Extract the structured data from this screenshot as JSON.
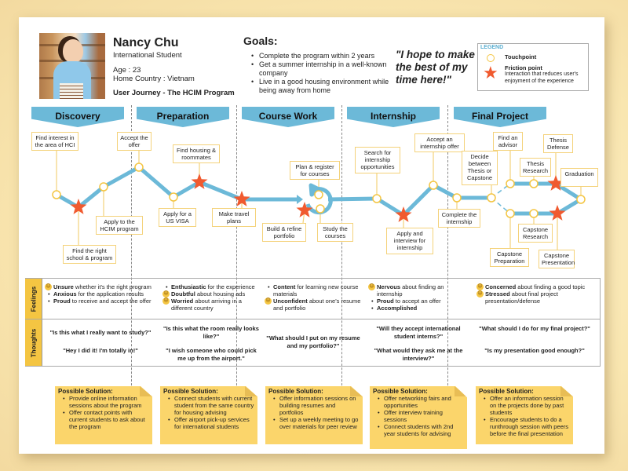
{
  "persona": {
    "name": "Nancy Chu",
    "role": "International Student",
    "age": "Age : 23",
    "country": "Home Country : Vietnam",
    "journey_title": "User Journey - The HCIM Program",
    "photo_icon": "persona-photo"
  },
  "goals": {
    "title": "Goals:",
    "items": [
      "Complete the program within 2 years",
      "Get a summer internship in a well-known company",
      "Live in a good housing environment while being away from home"
    ]
  },
  "quote": "\"I hope to make the best of my time here!\"",
  "legend": {
    "title": "LEGEND",
    "touchpoint_label": "Touchpoint",
    "friction_label": "Friction point",
    "friction_desc": "Interaction that reduces user's enjoyment of the experience",
    "touchpoint_icon": "circle-outline",
    "friction_icon": "star"
  },
  "colors": {
    "phase_header": "#6cb9d8",
    "path": "#6cb9d8",
    "touchpoint": "#f4c542",
    "friction": "#f05a2f",
    "note": "#fbd56b"
  },
  "phases": [
    {
      "label": "Discovery"
    },
    {
      "label": "Preparation"
    },
    {
      "label": "Course Work"
    },
    {
      "label": "Internship"
    },
    {
      "label": "Final Project"
    }
  ],
  "steps": [
    {
      "label": "Find interest in the area of HCI",
      "type": "touchpoint"
    },
    {
      "label": "Find the right school & program",
      "type": "friction"
    },
    {
      "label": "Apply to the HCIM program",
      "type": "touchpoint"
    },
    {
      "label": "Accept the offer",
      "type": "touchpoint"
    },
    {
      "label": "Apply for a US VISA",
      "type": "touchpoint"
    },
    {
      "label": "Find housing & roommates",
      "type": "friction"
    },
    {
      "label": "Make travel plans",
      "type": "friction"
    },
    {
      "label": "Plan & register for courses",
      "type": "touchpoint"
    },
    {
      "label": "Build & refine portfolio",
      "type": "friction"
    },
    {
      "label": "Study the courses",
      "type": "touchpoint"
    },
    {
      "label": "Search for internship opportunities",
      "type": "touchpoint"
    },
    {
      "label": "Apply and interview for internship",
      "type": "friction"
    },
    {
      "label": "Accept an internship offer",
      "type": "touchpoint"
    },
    {
      "label": "Complete the internship",
      "type": "touchpoint"
    },
    {
      "label": "Decide between Thesis or Capstone",
      "type": "touchpoint"
    },
    {
      "label": "Find an advisor",
      "type": "touchpoint"
    },
    {
      "label": "Thesis Research",
      "type": "touchpoint"
    },
    {
      "label": "Thesis Defense",
      "type": "friction"
    },
    {
      "label": "Capstone Preparation",
      "type": "touchpoint"
    },
    {
      "label": "Capstone Research",
      "type": "touchpoint"
    },
    {
      "label": "Capstone Presentation",
      "type": "friction"
    },
    {
      "label": "Graduation",
      "type": "touchpoint"
    }
  ],
  "rows": {
    "feelings_label": "Feelings",
    "thoughts_label": "Thoughts"
  },
  "feelings": [
    [
      {
        "marker": "sad",
        "bold": "Unsure",
        "rest": " whether it's the right program"
      },
      {
        "marker": "bullet",
        "bold": "Anxious",
        "rest": " for the application results"
      },
      {
        "marker": "bullet",
        "bold": "Proud",
        "rest": " to receive and accept the offer"
      }
    ],
    [
      {
        "marker": "bullet",
        "bold": "Enthusiastic",
        "rest": " for the experience"
      },
      {
        "marker": "sad",
        "bold": "Doubtful",
        "rest": " about housing ads"
      },
      {
        "marker": "sad",
        "bold": "Worried",
        "rest": " about arriving in a different country"
      }
    ],
    [
      {
        "marker": "bullet",
        "bold": "Content",
        "rest": " for learning new course materials"
      },
      {
        "marker": "sad",
        "bold": "Unconfident",
        "rest": " about one's resume and portfolio"
      }
    ],
    [
      {
        "marker": "sad",
        "bold": "Nervous",
        "rest": " about finding an internship"
      },
      {
        "marker": "bullet",
        "bold": "Proud",
        "rest": " to accept an offer"
      },
      {
        "marker": "bullet",
        "bold": "Accomplished",
        "rest": ""
      }
    ],
    [
      {
        "marker": "sad",
        "bold": "Concerned",
        "rest": " about finding a good topic"
      },
      {
        "marker": "sad",
        "bold": "Stressed",
        "rest": " about final project presentation/defense"
      }
    ]
  ],
  "thoughts": [
    [
      "\"Is this what I really want to study?\"",
      "\"Hey I did it! I'm totally in!\""
    ],
    [
      "\"Is this what the room really looks like?\"",
      "\"I wish someone who could pick me up from the airport.\""
    ],
    [
      "\"What should I put on my resume and my portfolio?\""
    ],
    [
      "\"Will they accept international student interns?\"",
      "\"What would they ask me at the interview?\""
    ],
    [
      "\"What should I do for my final project?\"",
      "\"Is my presentation good enough?\""
    ]
  ],
  "solutions": [
    {
      "title": "Possible Solution:",
      "items": [
        "Provide online information sessions about the program",
        "Offer contact points with current students to ask about the program"
      ]
    },
    {
      "title": "Possible Solution:",
      "items": [
        "Connect students with current student from the same country for housing advising",
        "Offer airport pick-up services for international students"
      ]
    },
    {
      "title": "Possible Solution:",
      "items": [
        "Offer information sessions on building resumes and portfolios",
        "Set up a weekly meeting to go over materials for peer review"
      ]
    },
    {
      "title": "Possible Solution:",
      "items": [
        "Offer networking fairs and opportunities",
        "Offer interview training sessions",
        "Connect students with 2nd year students for advising"
      ]
    },
    {
      "title": "Possible Solution:",
      "items": [
        "Offer an information session on the projects done by past students",
        "Encourage students to do a runthrough session with peers before the final presentation"
      ]
    }
  ]
}
